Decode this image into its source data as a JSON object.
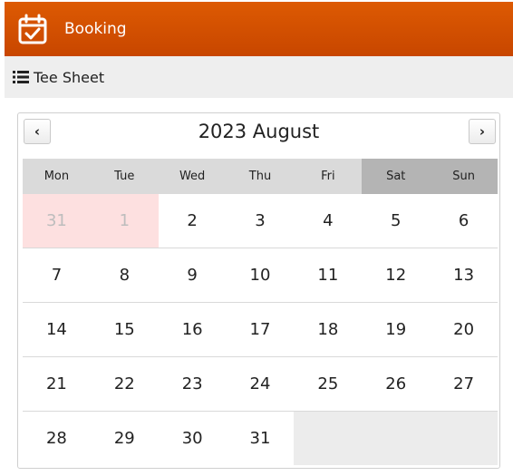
{
  "header": {
    "title": "Booking",
    "icon": "calendar-check-icon"
  },
  "subbar": {
    "label": "Tee Sheet",
    "icon": "list-icon"
  },
  "calendar": {
    "title": "2023 August",
    "prev_label": "‹",
    "next_label": "›",
    "weekdays": [
      "Mon",
      "Tue",
      "Wed",
      "Thu",
      "Fri",
      "Sat",
      "Sun"
    ],
    "weeks": [
      [
        "31",
        "1",
        "2",
        "3",
        "4",
        "5",
        "6"
      ],
      [
        "7",
        "8",
        "9",
        "10",
        "11",
        "12",
        "13"
      ],
      [
        "14",
        "15",
        "16",
        "17",
        "18",
        "19",
        "20"
      ],
      [
        "21",
        "22",
        "23",
        "24",
        "25",
        "26",
        "27"
      ],
      [
        "28",
        "29",
        "30",
        "31",
        "",
        "",
        ""
      ]
    ]
  },
  "colors": {
    "header": "#d14b00",
    "outside_day": "#fde0e0",
    "weekend_header": "#b4b4b4"
  }
}
